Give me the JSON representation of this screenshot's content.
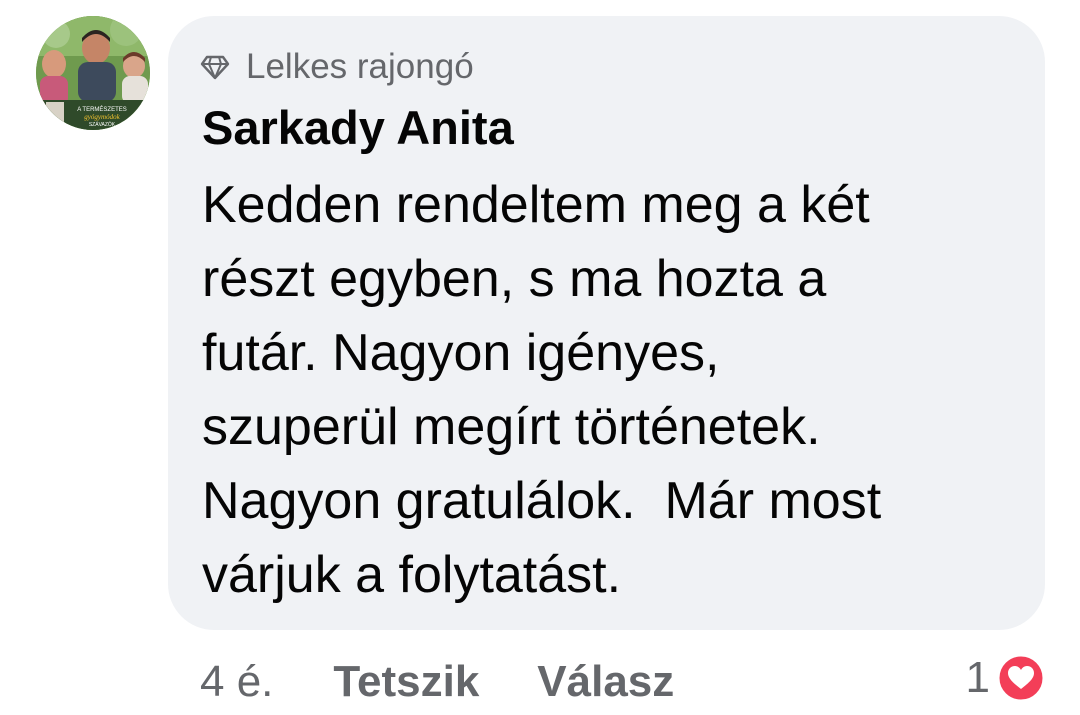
{
  "comment": {
    "badge": {
      "icon": "diamond-icon",
      "label": "Lelkes rajongó"
    },
    "author": "Sarkady Anita",
    "text_lines": [
      "Kedden rendeltem meg a két",
      "részt egyben, s ma hozta a",
      "futár. Nagyon igényes,",
      "szuperül megírt történetek.",
      "Nagyon gratulálok.  Már most",
      "várjuk a folytatást."
    ],
    "avatar": {
      "icon": "profile-photo",
      "caption_lines": [
        "A TERMÉSZETES",
        "gyógymódok",
        "SZÁVAZÓK"
      ]
    },
    "actions": {
      "timestamp": "4 é.",
      "like_label": "Tetszik",
      "reply_label": "Válasz"
    },
    "reactions": {
      "count": "1",
      "icon": "heart-icon",
      "color": "#f33e58"
    }
  },
  "colors": {
    "bubble_bg": "#f0f2f5",
    "primary_text": "#050505",
    "secondary_text": "#65676b"
  }
}
